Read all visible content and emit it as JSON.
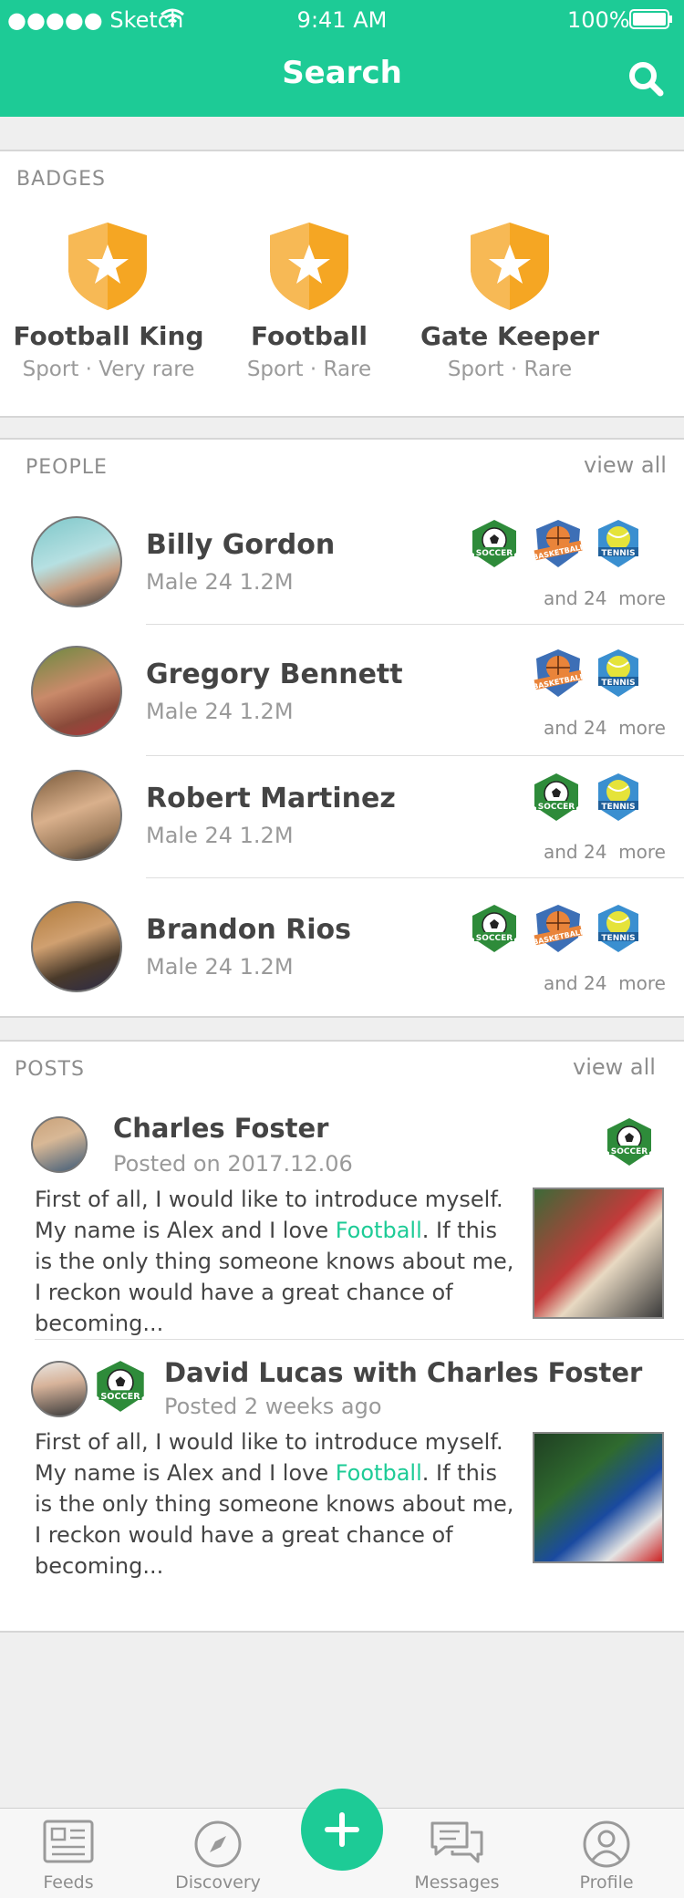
{
  "status_bar": {
    "carrier": "●●●●● Sketch",
    "time": "9:41 AM",
    "battery": "100%"
  },
  "header": {
    "title": "Search"
  },
  "badges": {
    "heading": "BADGES",
    "items": [
      {
        "name": "Football King",
        "sub": "Sport · Very rare"
      },
      {
        "name": "Football",
        "sub": "Sport · Rare"
      },
      {
        "name": "Gate Keeper",
        "sub": "Sport · Rare"
      }
    ]
  },
  "people": {
    "heading": "PEOPLE",
    "view_all": "view all",
    "items": [
      {
        "name": "Billy Gordon",
        "meta": "Male  24  1.2M",
        "more": "and 24  more",
        "sports": [
          "SOCCER",
          "BASKETBALL",
          "TENNIS"
        ]
      },
      {
        "name": "Gregory Bennett",
        "meta": "Male  24  1.2M",
        "more": "and 24  more",
        "sports": [
          "BASKETBALL",
          "TENNIS"
        ]
      },
      {
        "name": "Robert Martinez",
        "meta": "Male  24  1.2M",
        "more": "and 24  more",
        "sports": [
          "SOCCER",
          "TENNIS"
        ]
      },
      {
        "name": "Brandon Rios",
        "meta": "Male  24  1.2M",
        "more": "and 24  more",
        "sports": [
          "SOCCER",
          "BASKETBALL",
          "TENNIS"
        ]
      }
    ]
  },
  "posts": {
    "heading": "POSTS",
    "view_all": "view all",
    "items": [
      {
        "author": "Charles Foster",
        "date": "Posted on 2017.12.06",
        "text_before": "First of all, I would like to introduce myself. My name is Alex and I love ",
        "text_link": "Football",
        "text_after": ". If this is the only thing someone knows about me, I reckon would have a great chance of becoming...",
        "badge": "SOCCER"
      },
      {
        "author": "David Lucas with Charles Foster",
        "date": "Posted 2 weeks ago",
        "text_before": "First of all, I would like to introduce myself. My name is Alex and I love ",
        "text_link": "Football",
        "text_after": ". If this is the only thing someone knows about me, I reckon would have a great chance of becoming...",
        "badge": "SOCCER"
      }
    ]
  },
  "tabbar": {
    "items": [
      {
        "label": "Feeds",
        "icon": "feeds-icon"
      },
      {
        "label": "Discovery",
        "icon": "compass-icon"
      },
      {
        "label": "",
        "icon": "plus-icon"
      },
      {
        "label": "Messages",
        "icon": "messages-icon"
      },
      {
        "label": "Profile",
        "icon": "profile-icon"
      }
    ]
  },
  "colors": {
    "accent": "#1dcb96",
    "badge_gold": "#f5a623",
    "soccer_green": "#2e8b3a",
    "basketball_blue": "#3d6fb6",
    "tennis_blue": "#3a8fd0"
  }
}
